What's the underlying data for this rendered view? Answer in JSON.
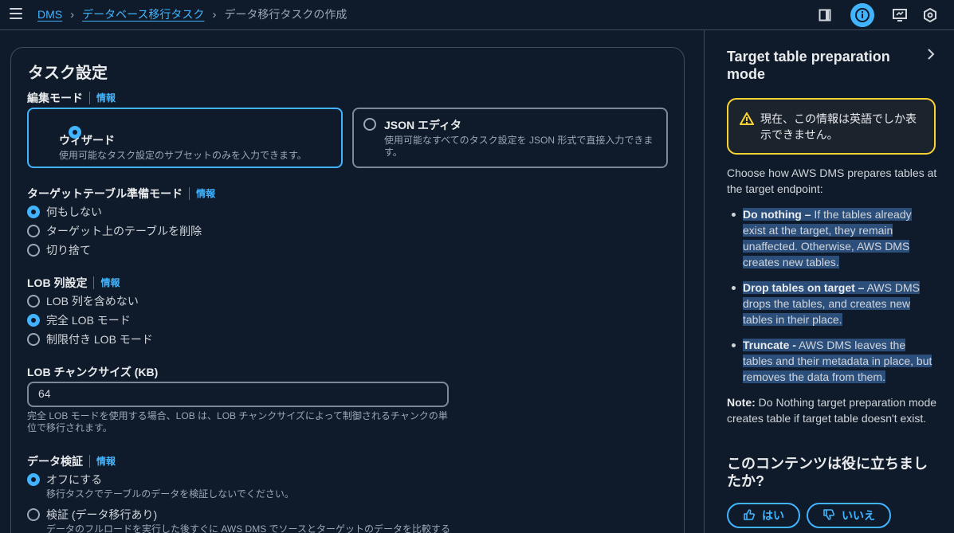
{
  "breadcrumbs": {
    "root": "DMS",
    "parent": "データベース移行タスク",
    "current": "データ移行タスクの作成"
  },
  "task_settings": {
    "title": "タスク設定",
    "info_label": "情報",
    "edit_mode": {
      "label": "編集モード",
      "options": [
        {
          "title": "ウィザード",
          "description": "使用可能なタスク設定のサブセットのみを入力できます。",
          "selected": true
        },
        {
          "title": "JSON エディタ",
          "description": "使用可能なすべてのタスク設定を JSON 形式で直接入力できます。",
          "selected": false
        }
      ]
    },
    "target_prep_mode": {
      "label": "ターゲットテーブル準備モード",
      "options": [
        {
          "label": "何もしない",
          "selected": true
        },
        {
          "label": "ターゲット上のテーブルを削除",
          "selected": false
        },
        {
          "label": "切り捨て",
          "selected": false
        }
      ]
    },
    "lob_settings": {
      "label": "LOB 列設定",
      "options": [
        {
          "label": "LOB 列を含めない",
          "selected": false
        },
        {
          "label": "完全 LOB モード",
          "selected": true
        },
        {
          "label": "制限付き LOB モード",
          "selected": false
        }
      ]
    },
    "lob_chunk": {
      "label": "LOB チャンクサイズ (KB)",
      "value": "64",
      "hint": "完全 LOB モードを使用する場合、LOB は、LOB チャンクサイズによって制御されるチャンクの単位で移行されます。"
    },
    "data_validation": {
      "label": "データ検証",
      "options": [
        {
          "label": "オフにする",
          "description": "移行タスクでテーブルのデータを検証しないでください。",
          "selected": true
        },
        {
          "label": "検証 (データ移行あり)",
          "description": "データのフルロードを実行した後すぐに AWS DMS でソースとターゲットのデータを比較する",
          "selected": false
        }
      ]
    }
  },
  "help_panel": {
    "title": "Target table preparation mode",
    "alert": "現在、この情報は英語でしか表示できません。",
    "intro": "Choose how AWS DMS prepares tables at the target endpoint:",
    "items": [
      {
        "term": "Do nothing –",
        "text": " If the tables already exist at the target, they remain unaffected. Otherwise, AWS DMS creates new tables."
      },
      {
        "term": "Drop tables on target –",
        "text": " AWS DMS drops the tables, and creates new tables in their place."
      },
      {
        "term": "Truncate -",
        "text": " AWS DMS leaves the tables and their metadata in place, but removes the data from them."
      }
    ],
    "note_term": "Note:",
    "note_text": " Do Nothing target preparation mode creates table if target table doesn't exist.",
    "feedback_title": "このコンテンツは役に立ちましたか?",
    "yes_label": "はい",
    "no_label": "いいえ"
  },
  "colors": {
    "background": "#0f1b2a",
    "accent": "#42b4ff",
    "warning": "#fbd332",
    "selection": "#2b4f7a"
  }
}
